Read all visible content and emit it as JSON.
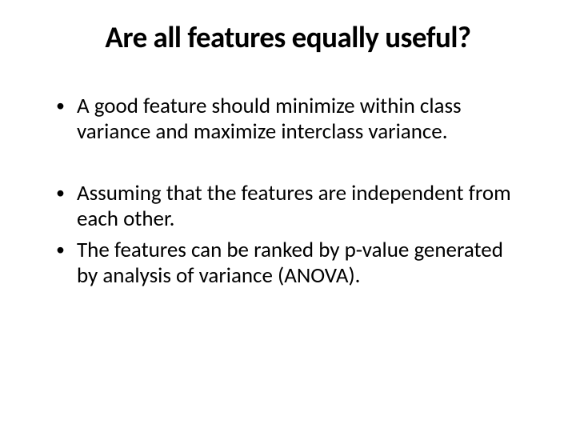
{
  "slide": {
    "title": "Are all features equally useful?",
    "bullets": [
      "A good feature should minimize within class variance and maximize interclass variance.",
      "Assuming that the features are independent from each other.",
      "The features can be ranked by p-value generated by analysis of variance (ANOVA)."
    ]
  }
}
